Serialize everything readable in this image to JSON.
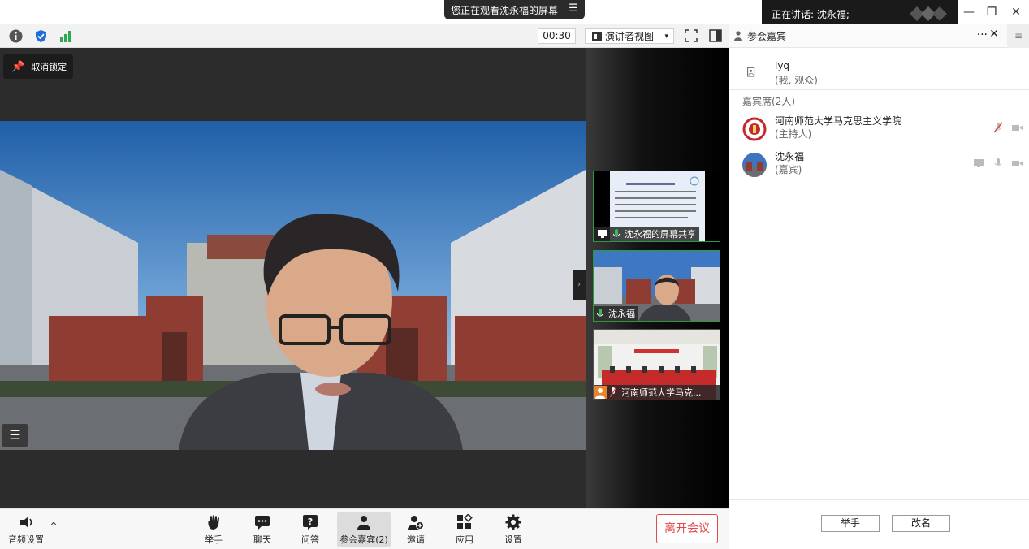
{
  "titlebar": {
    "share_notice": "您正在观看沈永福的屏幕",
    "speaking": "正在讲话: 沈永福;",
    "minimize_glyph": "—",
    "restore_glyph": "❐",
    "close_glyph": "✕"
  },
  "toolbar": {
    "timer": "00:30",
    "view_mode": "演讲者视图",
    "caret": "▾"
  },
  "stage": {
    "unlock_label": "取消锁定",
    "list_glyph": "☰",
    "collapse_glyph": "›"
  },
  "thumbnails": [
    {
      "label": "沈永福的屏幕共享"
    },
    {
      "label": "沈永福"
    },
    {
      "label": "河南师范大学马克..."
    }
  ],
  "panel": {
    "title": "参会嘉宾",
    "menu_glyph": "···",
    "close_glyph": "✕",
    "side_glyph": "≡",
    "self": {
      "name": "lyq",
      "role": "(我, 观众)"
    },
    "section": "嘉宾席(2人)",
    "guests": [
      {
        "name": "河南师范大学马克思主义学院",
        "role": "(主持人)"
      },
      {
        "name": "沈永福",
        "role": "(嘉宾)"
      }
    ],
    "raise_hand": "举手",
    "rename": "改名"
  },
  "bottombar": {
    "audio": "音频设置",
    "audio_caret": "^",
    "items": [
      {
        "label": "举手"
      },
      {
        "label": "聊天"
      },
      {
        "label": "问答"
      },
      {
        "label": "参会嘉宾(2)"
      },
      {
        "label": "邀请"
      },
      {
        "label": "应用"
      },
      {
        "label": "设置"
      }
    ],
    "leave": "离开会议"
  },
  "colors": {
    "accent_green": "#2b9a3f",
    "leave_red": "#e04a4a",
    "dark_bg": "#2c2c2c"
  }
}
